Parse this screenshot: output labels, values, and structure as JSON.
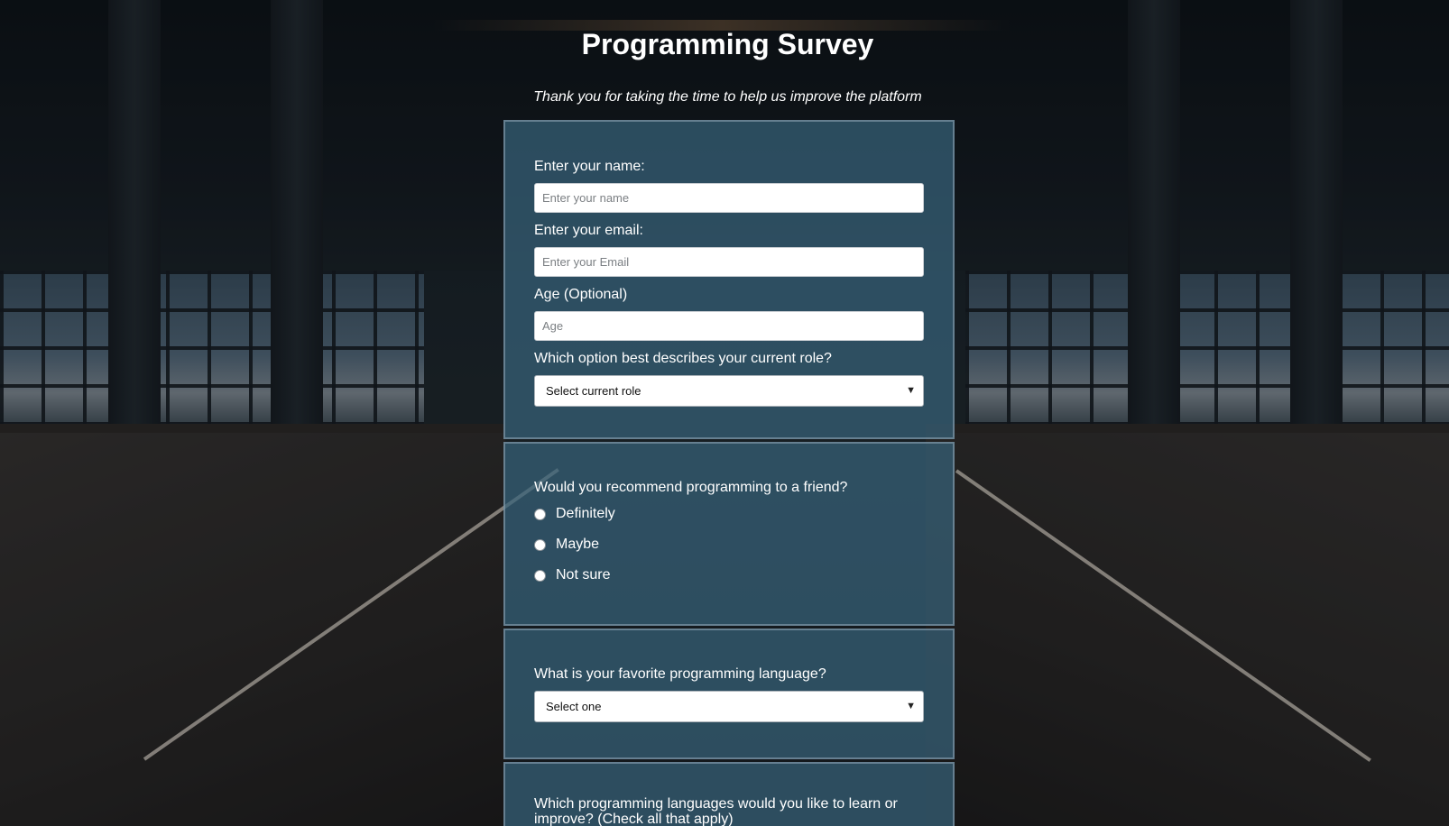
{
  "header": {
    "title": "Programming Survey",
    "subtitle": "Thank you for taking the time to help us improve the platform"
  },
  "form": {
    "name": {
      "label": "Enter your name:",
      "placeholder": "Enter your name"
    },
    "email": {
      "label": "Enter your email:",
      "placeholder": "Enter your Email"
    },
    "age": {
      "label": "Age (Optional)",
      "placeholder": "Age"
    },
    "role": {
      "label": "Which option best describes your current role?",
      "selected": "Select current role"
    },
    "recommend": {
      "label": "Would you recommend programming to a friend?",
      "options": [
        "Definitely",
        "Maybe",
        "Not sure"
      ]
    },
    "favorite_language": {
      "label": "What is your favorite programming language?",
      "selected": "Select one"
    },
    "learn_languages": {
      "label": "Which programming languages would you like to learn or improve? (Check all that apply)"
    }
  },
  "icons": {
    "dropdown": "chevron-down-icon"
  },
  "colors": {
    "card_background": "#37627a",
    "text": "#ffffff"
  }
}
